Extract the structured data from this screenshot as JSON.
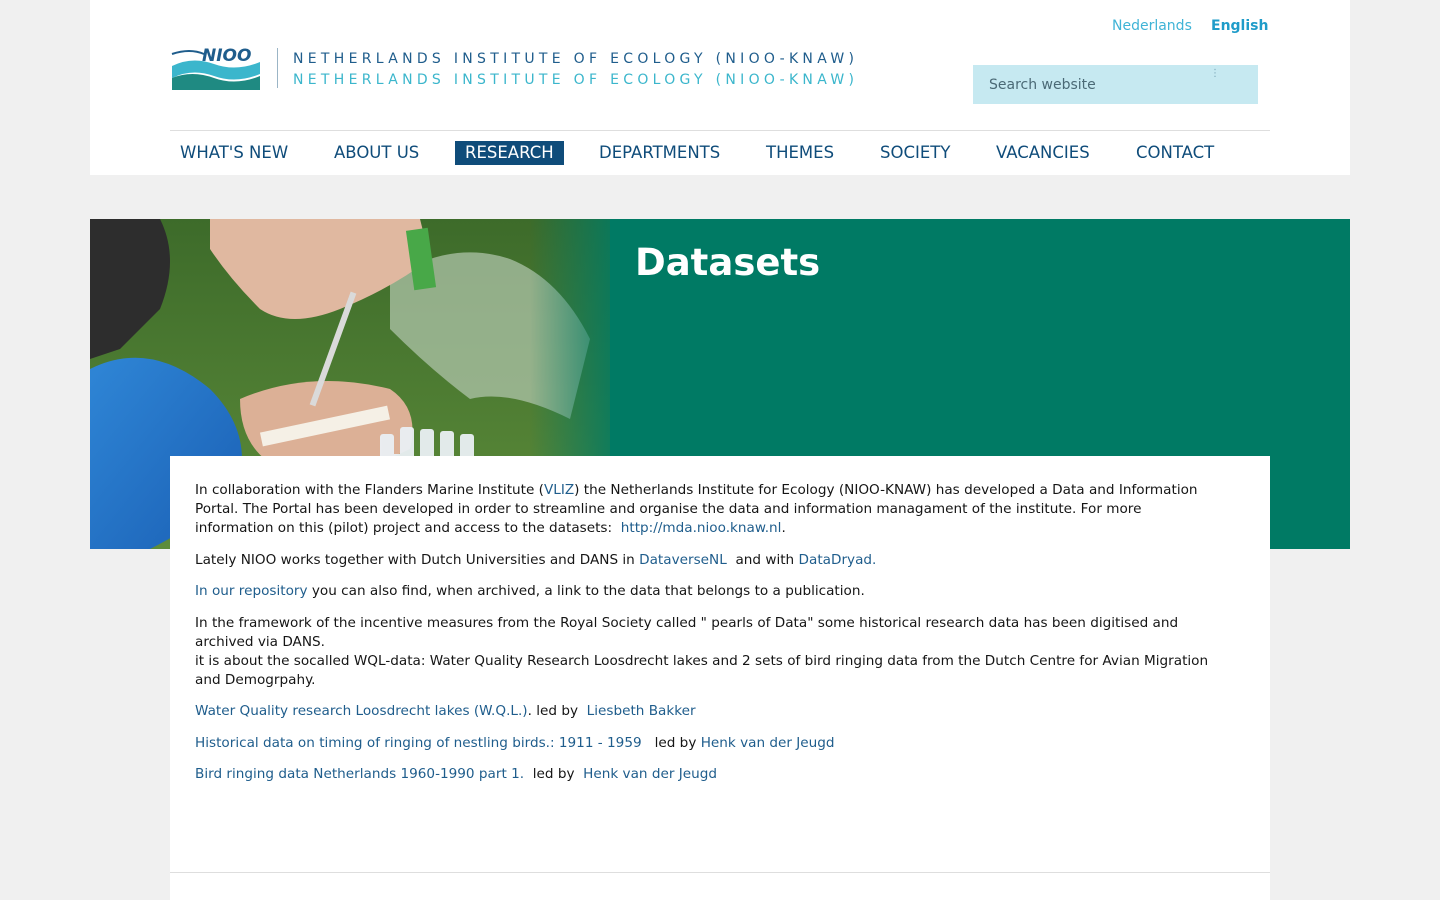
{
  "header": {
    "languages": {
      "nl": "Nederlands",
      "en": "English"
    },
    "institute_name_line1": "NETHERLANDS INSTITUTE OF ECOLOGY (NIOO-KNAW)",
    "institute_name_line2": "NETHERLANDS INSTITUTE OF ECOLOGY (NIOO-KNAW)",
    "logo_text": "NIOO",
    "search_placeholder": "Search website"
  },
  "nav": {
    "items": [
      {
        "label": "WHAT'S NEW"
      },
      {
        "label": "ABOUT US"
      },
      {
        "label": "RESEARCH",
        "active": true
      },
      {
        "label": "DEPARTMENTS"
      },
      {
        "label": "THEMES"
      },
      {
        "label": "SOCIETY"
      },
      {
        "label": "VACANCIES"
      },
      {
        "label": "CONTACT"
      }
    ]
  },
  "banner": {
    "title": "Datasets"
  },
  "content": {
    "p1": {
      "t1": "In collaboration with the Flanders Marine Institute (",
      "link_vliz": "VLIZ",
      "t2": ") the Netherlands Institute for Ecology (NIOO-KNAW) has developed a Data and Information Portal. The Portal has been developed in order to streamline and organise the data and information managament of the institute. For more information on this (pilot) project and access to the datasets:",
      "link_mda": "http://mda.nioo.knaw.nl",
      "t3": "."
    },
    "p2": {
      "t1": "Lately NIOO works together with Dutch Universities and DANS in",
      "link_dataverse": "DataverseNL",
      "t2": "and with",
      "link_datadryad": "DataDryad."
    },
    "p3": {
      "link_repository": "In our repository",
      "t1": "you can also find, when archived, a link to the data that belongs to a publication."
    },
    "p4": {
      "line1": "In the framework of the incentive measures from the Royal Society called \" pearls of Data\" some historical research data has been digitised and archived via DANS.",
      "line2": "it is about the socalled WQL-data: Water Quality Research Loosdrecht lakes and 2 sets of bird ringing data from the Dutch Centre for Avian Migration and Demogrpahy."
    },
    "datasets": [
      {
        "title": "Water Quality research Loosdrecht lakes (W.Q.L.)",
        "sep": ".  led by",
        "lead": "Liesbeth Bakker"
      },
      {
        "title": "Historical data on timing of ringing of nestling birds.: 1911 - 1959",
        "sep": "led by",
        "lead": "Henk van der Jeugd"
      },
      {
        "title": "Bird ringing data Netherlands 1960-1990 part 1.",
        "sep": "led by",
        "lead": "Henk van der Jeugd"
      }
    ]
  },
  "colors": {
    "brand_blue": "#0f4c7a",
    "accent_cyan": "#3fb3d6",
    "banner_green": "#007a64",
    "search_bg": "#c6e9f1"
  }
}
